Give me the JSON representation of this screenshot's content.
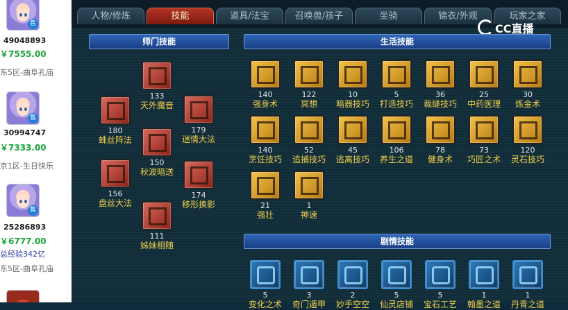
{
  "listings": [
    {
      "id": "49048893",
      "price": "￥7555.00",
      "server": "东5区-曲阜孔庙",
      "sale_badge": "售"
    },
    {
      "id": "30994747",
      "price": "￥7333.00",
      "server": "京1区-生日快乐",
      "sale_badge": "售"
    },
    {
      "id": "25286893",
      "price": "￥6777.00",
      "exp": "总经验342亿",
      "server": "东5区-曲阜孔庙",
      "sale_badge": "售"
    }
  ],
  "tabs": [
    "人物/修炼",
    "技能",
    "道具/法宝",
    "召唤兽/孩子",
    "坐骑",
    "锦衣/外观",
    "玩家之家"
  ],
  "active_tab": "技能",
  "watermark": "CC直播",
  "sections": {
    "master": "师门技能",
    "life": "生活技能",
    "story": "剧情技能"
  },
  "master_skills": [
    {
      "level": "133",
      "name": "天外魔音"
    },
    {
      "level": "180",
      "name": "蛛丝阵法"
    },
    {
      "level": "179",
      "name": "迷情大法"
    },
    {
      "level": "150",
      "name": "秋波暗送"
    },
    {
      "level": "156",
      "name": "盘丝大法"
    },
    {
      "level": "174",
      "name": "移形换影"
    },
    {
      "level": "111",
      "name": "姊妹相随"
    }
  ],
  "life_skills": [
    {
      "level": "140",
      "name": "强身术"
    },
    {
      "level": "122",
      "name": "冥想"
    },
    {
      "level": "10",
      "name": "暗器技巧"
    },
    {
      "level": "5",
      "name": "打造技巧"
    },
    {
      "level": "36",
      "name": "裁缝技巧"
    },
    {
      "level": "25",
      "name": "中药医理"
    },
    {
      "level": "30",
      "name": "炼金术"
    },
    {
      "level": "140",
      "name": "烹饪技巧"
    },
    {
      "level": "52",
      "name": "追捕技巧"
    },
    {
      "level": "45",
      "name": "逃离技巧"
    },
    {
      "level": "106",
      "name": "养生之道"
    },
    {
      "level": "78",
      "name": "健身术"
    },
    {
      "level": "73",
      "name": "巧匠之术"
    },
    {
      "level": "120",
      "name": "灵石技巧"
    },
    {
      "level": "21",
      "name": "强壮"
    },
    {
      "level": "1",
      "name": "神速"
    }
  ],
  "story_skills": [
    {
      "level": "5",
      "name": "变化之术"
    },
    {
      "level": "3",
      "name": "奇门遁甲"
    },
    {
      "level": "2",
      "name": "妙手空空"
    },
    {
      "level": "5",
      "name": "仙灵店铺"
    },
    {
      "level": "5",
      "name": "宝石工艺"
    },
    {
      "level": "1",
      "name": "翰墨之道"
    },
    {
      "level": "1",
      "name": "丹青之道"
    }
  ]
}
